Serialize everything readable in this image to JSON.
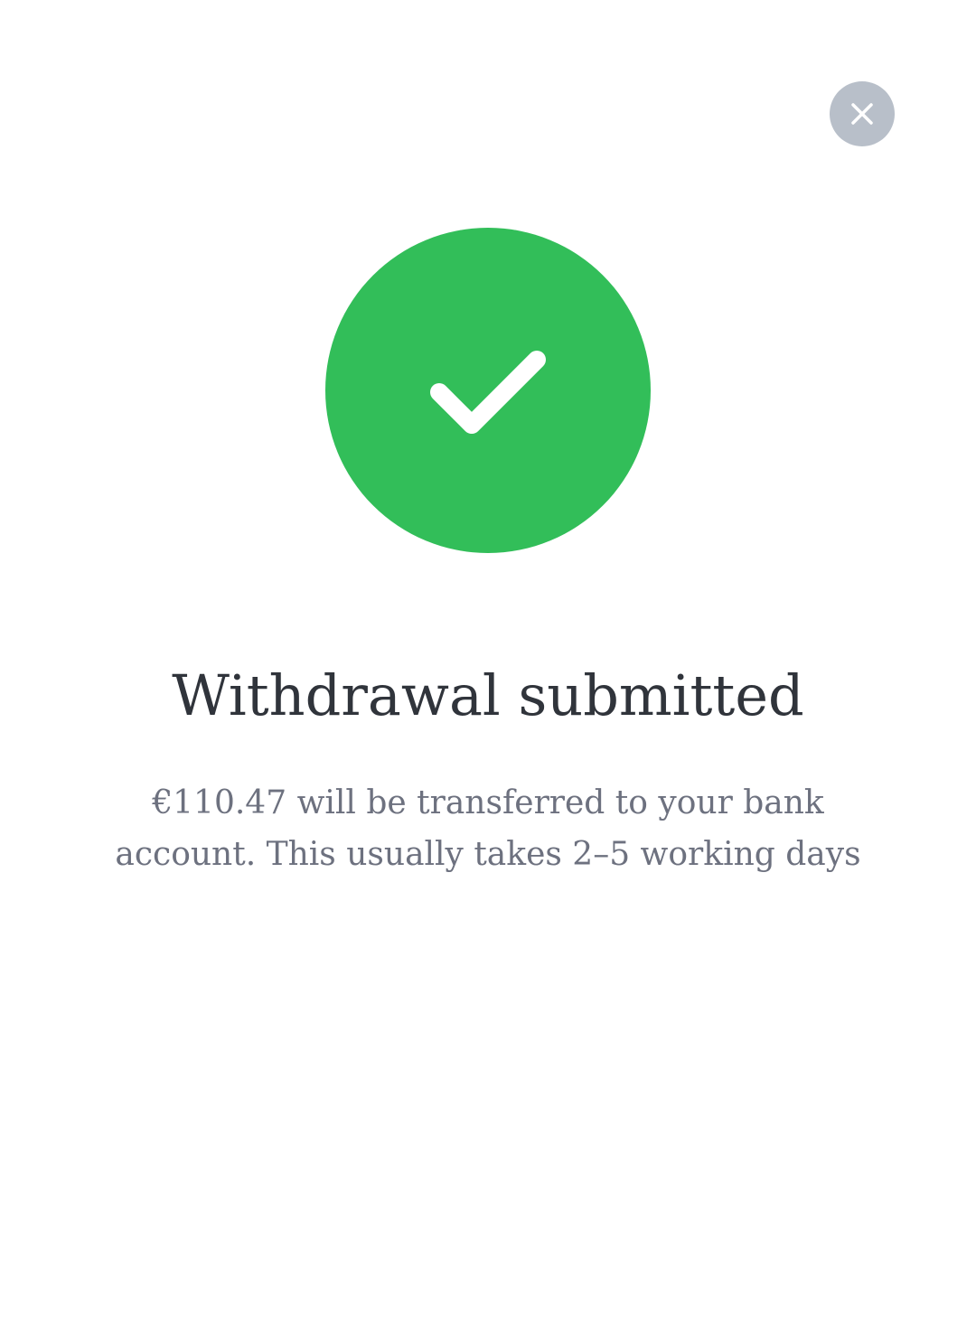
{
  "close_button": {
    "icon": "close-icon",
    "background_color": "#b8bfc9"
  },
  "status": {
    "icon": "checkmark-icon",
    "color": "#32be59"
  },
  "title": "Withdrawal submitted",
  "message": "€110.47 will be transferred to your bank account. This usually takes 2–5 working days",
  "colors": {
    "title": "#30343b",
    "message": "#6d717f",
    "background": "#ffffff"
  }
}
